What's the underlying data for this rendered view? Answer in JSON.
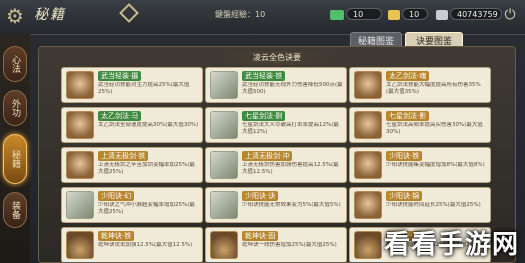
{
  "header": {
    "title": "秘籍",
    "exp_label": "鍵盤經驗：10",
    "currency_green": "10",
    "currency_gold": "10",
    "silver": "40743759"
  },
  "sidebar": {
    "items": [
      {
        "label": "心法"
      },
      {
        "label": "外功"
      },
      {
        "label": "秘籍"
      },
      {
        "label": "装备"
      }
    ]
  },
  "tabs": [
    {
      "label": "秘籍图鉴"
    },
    {
      "label": "诀要图鉴"
    }
  ],
  "panel": {
    "title": "凌云全色诀要"
  },
  "cards": [
    {
      "name": "武当轻装·摄",
      "desc": "武当轻功技能对主力提高25%(最大值25%)",
      "style": "green"
    },
    {
      "name": "武当轻装·铁",
      "desc": "武当轻功技能无视外力伤害降低500点(最大值500)",
      "style": "green"
    },
    {
      "name": "太乙剑法·魂",
      "desc": "太乙剑法技能大幅度提高所有伤害35%(最大值35%)",
      "style": "gold"
    },
    {
      "name": "太乙剑法·马",
      "desc": "太乙剑法全部速度提高30%(最大值30%)",
      "style": "green"
    },
    {
      "name": "七星剑法·剔",
      "desc": "七星剑法大义尽破高打击率提高12%(最大值12%)",
      "style": "green"
    },
    {
      "name": "七星剑法·影",
      "desc": "七星剑法高频率提高实伤害30%(最大值30%)",
      "style": "gold"
    },
    {
      "name": "上清无极剑·铁",
      "desc": "上清无极剑之辛苦加剑变幅率加25%(最大值25%)",
      "style": "gold"
    },
    {
      "name": "上清无极剑·冲",
      "desc": "上清无极剑伤害加强伤害提高12.5%(最大值12.5%)",
      "style": "gold"
    },
    {
      "name": "少阳诀·铁",
      "desc": "少阳诀技能集变幅度增加8%(最大值8%)",
      "style": "gold"
    },
    {
      "name": "少阳诀·幻",
      "desc": "少阳诀之气冲小脉超变幅率增加25%(最大值25%)",
      "style": "gold"
    },
    {
      "name": "少阳诀·诀",
      "desc": "少阳诀技能无常效果变为5%(最大值5%)",
      "style": "gold"
    },
    {
      "name": "少阳诀·锦",
      "desc": "少阳诀技能时间延长25%(最大值25%)",
      "style": "gold"
    },
    {
      "name": "乾坤诀·铁",
      "desc": "乾坤诀攻击加强12.5%(最大值12.5%)",
      "style": "gold"
    },
    {
      "name": "乾坤诀·固",
      "desc": "乾坤诀一线伤害增加25%(最大值25%)",
      "style": "gold"
    },
    {
      "name": "乾坤诀·流",
      "desc": "乾坤诀技能伤害提高25%(最大值25%)",
      "style": "gold"
    }
  ],
  "watermark": "看看手游网"
}
